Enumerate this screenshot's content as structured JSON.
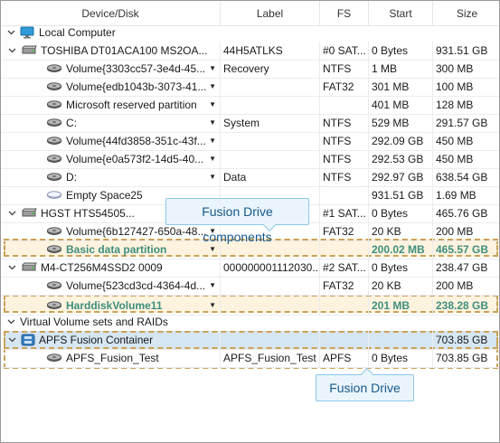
{
  "columns": {
    "device": "Device/Disk",
    "label": "Label",
    "fs": "FS",
    "start": "Start",
    "size": "Size"
  },
  "groups": {
    "local": "Local Computer",
    "virtual": "Virtual Volume sets and RAIDs"
  },
  "rows": [
    {
      "name": "TOSHIBA DT01ACA100 MS2OA...",
      "label": "44H5ATLKS",
      "fs": "#0 SAT...",
      "start": "0 Bytes",
      "size": "931.51 GB"
    },
    {
      "name": "Volume{3303cc57-3e4d-45...",
      "label": "Recovery",
      "fs": "NTFS",
      "start": "1 MB",
      "size": "300 MB"
    },
    {
      "name": "Volume{edb1043b-3073-41...",
      "label": "",
      "fs": "FAT32",
      "start": "301 MB",
      "size": "100 MB"
    },
    {
      "name": "Microsoft reserved partition",
      "label": "",
      "fs": "",
      "start": "401 MB",
      "size": "128 MB"
    },
    {
      "name": "C:",
      "label": "System",
      "fs": "NTFS",
      "start": "529 MB",
      "size": "291.57 GB"
    },
    {
      "name": "Volume{44fd3858-351c-43f...",
      "label": "",
      "fs": "NTFS",
      "start": "292.09 GB",
      "size": "450 MB"
    },
    {
      "name": "Volume{e0a573f2-14d5-40...",
      "label": "",
      "fs": "NTFS",
      "start": "292.53 GB",
      "size": "450 MB"
    },
    {
      "name": "D:",
      "label": "Data",
      "fs": "NTFS",
      "start": "292.97 GB",
      "size": "638.54 GB"
    },
    {
      "name": "Empty Space25",
      "label": "",
      "fs": "",
      "start": "931.51 GB",
      "size": "1.69 MB"
    },
    {
      "name": "HGST HTS54505...",
      "label": "",
      "fs": "#1 SAT...",
      "start": "0 Bytes",
      "size": "465.76 GB"
    },
    {
      "name": "Volume{6b127427-650a-48...",
      "label": "",
      "fs": "FAT32",
      "start": "20 KB",
      "size": "200 MB"
    },
    {
      "name": "Basic data partition",
      "label": "",
      "fs": "",
      "start": "200.02 MB",
      "size": "465.57 GB"
    },
    {
      "name": "M4-CT256M4SSD2 0009",
      "label": "000000001112030...",
      "fs": "#2 SAT...",
      "start": "0 Bytes",
      "size": "238.47 GB"
    },
    {
      "name": "Volume{523cd3cd-4364-4d...",
      "label": "",
      "fs": "FAT32",
      "start": "20 KB",
      "size": "200 MB"
    },
    {
      "name": "HarddiskVolume11",
      "label": "",
      "fs": "",
      "start": "201 MB",
      "size": "238.28 GB"
    },
    {
      "name": "APFS Fusion Container",
      "label": "",
      "fs": "",
      "start": "",
      "size": "703.85 GB"
    },
    {
      "name": "APFS_Fusion_Test",
      "label": "APFS_Fusion_Test",
      "fs": "APFS",
      "start": "0 Bytes",
      "size": "703.85 GB"
    }
  ],
  "callouts": {
    "components": "Fusion Drive components",
    "drive": "Fusion Drive"
  },
  "colors": {
    "highlight_border": "#c9a35a",
    "highlight_fill": "#fdf3df",
    "bold_text": "#3e8f7c",
    "callout_text": "#17588c",
    "selected_row": "#d6e6f2"
  }
}
